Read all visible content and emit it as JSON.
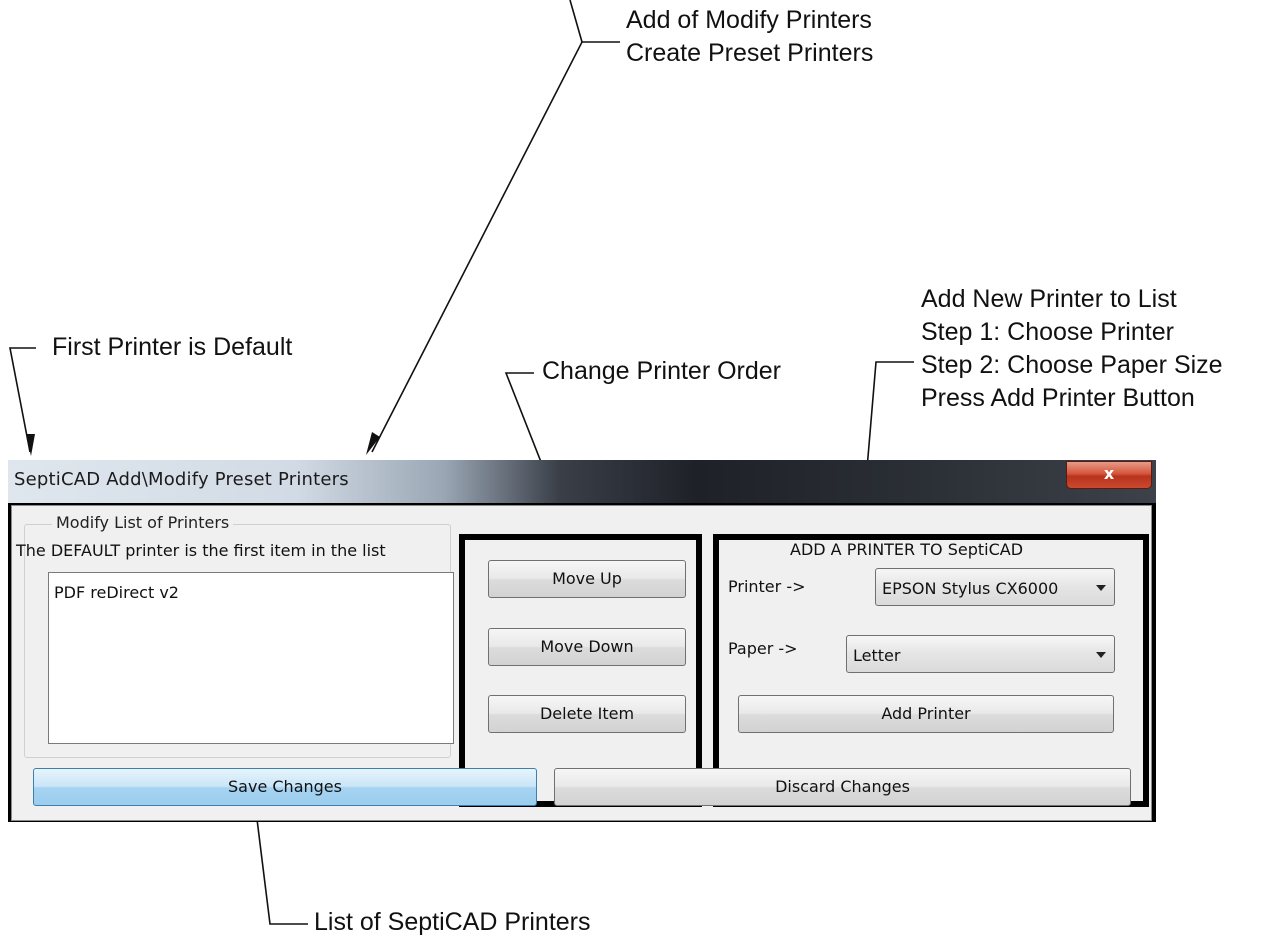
{
  "window": {
    "title": "SeptiCAD Add\\Modify Preset Printers",
    "close_label": "x"
  },
  "group": {
    "legend": "Modify List of Printers",
    "note": "The DEFAULT printer is the first item in the list",
    "printers": [
      "PDF reDirect v2"
    ]
  },
  "order_buttons": {
    "move_up": "Move Up",
    "move_down": "Move Down",
    "delete_item": "Delete Item"
  },
  "add_section": {
    "header": "ADD A PRINTER TO SeptiCAD",
    "printer_label": "Printer ->",
    "printer_value": "EPSON Stylus CX6000",
    "paper_label": "Paper ->",
    "paper_value": "Letter",
    "add_button": "Add Printer"
  },
  "footer": {
    "save": "Save Changes",
    "discard": "Discard Changes"
  },
  "annotations": {
    "top": [
      "Add of Modify Printers",
      "Create Preset Printers"
    ],
    "first_default": "First Printer is Default",
    "change_order": "Change Printer Order",
    "add_new": [
      "Add New Printer to List",
      "Step 1: Choose Printer",
      "Step 2: Choose Paper Size",
      "Press Add Printer Button"
    ],
    "list": "List of SeptiCAD Printers"
  },
  "colors": {
    "save_button_fill": "#a6d3f0",
    "close_button_fill": "#c94a30",
    "highlight_border": "#000000"
  }
}
